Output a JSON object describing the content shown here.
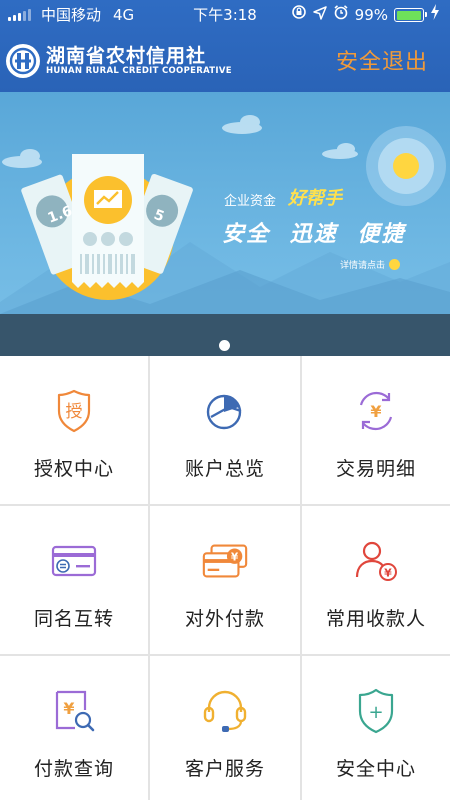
{
  "status": {
    "carrier": "中国移动",
    "network": "4G",
    "time": "下午3:18",
    "battery": "99%",
    "battery_level": 0.99
  },
  "header": {
    "logo_cn": "湖南省农村信用社",
    "logo_en": "HUNAN RURAL CREDIT COOPERATIVE",
    "logout_label": "安全退出",
    "accent_color": "#f09a3a",
    "bg_color": "#2f6cc3"
  },
  "banner": {
    "line1_prefix": "企业资金",
    "line1_highlight": "好帮手",
    "line2": "安全 迅速 便捷",
    "detail_link": "详情请点击",
    "badge_left": "1.6",
    "badge_right": "5",
    "slide_count": 1
  },
  "menu": [
    {
      "label": "授权中心",
      "icon": "authorization-shield-icon",
      "icon_text": "授"
    },
    {
      "label": "账户总览",
      "icon": "account-pie-chart-icon"
    },
    {
      "label": "交易明细",
      "icon": "transaction-yen-cycle-icon",
      "icon_text": "¥"
    },
    {
      "label": "同名互转",
      "icon": "same-name-transfer-card-icon"
    },
    {
      "label": "对外付款",
      "icon": "external-payment-cards-icon",
      "icon_text": "¥"
    },
    {
      "label": "常用收款人",
      "icon": "frequent-payee-person-icon",
      "icon_text": "¥"
    },
    {
      "label": "付款查询",
      "icon": "payment-query-search-icon",
      "icon_text": "¥"
    },
    {
      "label": "客户服务",
      "icon": "customer-service-headset-icon"
    },
    {
      "label": "安全中心",
      "icon": "security-shield-plus-icon",
      "icon_text": "+"
    }
  ]
}
